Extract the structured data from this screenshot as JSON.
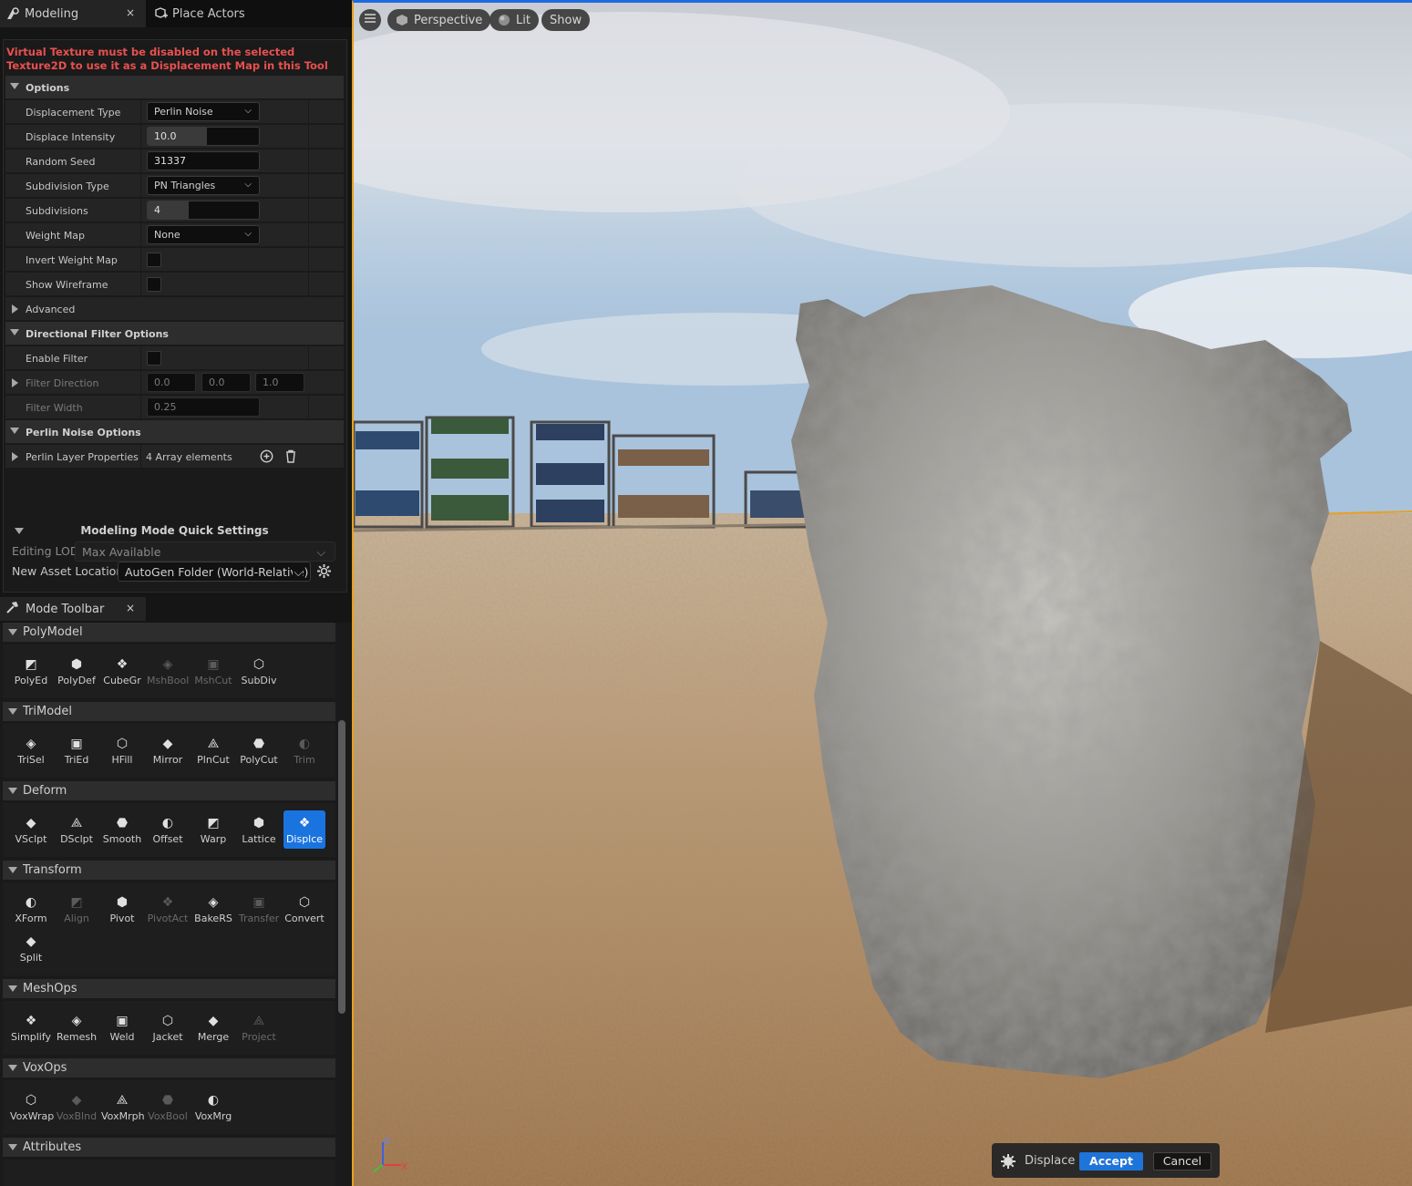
{
  "tabs": {
    "modeling": "Modeling",
    "place_actors": "Place Actors",
    "close": "×"
  },
  "warning": "Virtual Texture must be disabled on the selected Texture2D to use it as a Displacement Map in this Tool",
  "options": {
    "section": "Options",
    "displacement_type": {
      "label": "Displacement Type",
      "value": "Perlin Noise"
    },
    "displace_intensity": {
      "label": "Displace Intensity",
      "value": "10.0",
      "slider_fraction": 0.53
    },
    "random_seed": {
      "label": "Random Seed",
      "value": "31337"
    },
    "subdivision_type": {
      "label": "Subdivision Type",
      "value": "PN Triangles"
    },
    "subdivisions": {
      "label": "Subdivisions",
      "value": "4",
      "slider_fraction": 0.37
    },
    "weight_map": {
      "label": "Weight Map",
      "value": "None"
    },
    "invert_weight_map": {
      "label": "Invert Weight Map",
      "checked": false
    },
    "show_wireframe": {
      "label": "Show Wireframe",
      "checked": false
    },
    "advanced": "Advanced"
  },
  "directional": {
    "section": "Directional Filter Options",
    "enable_filter": {
      "label": "Enable Filter",
      "checked": false
    },
    "filter_direction": {
      "label": "Filter Direction",
      "x": "0.0",
      "y": "0.0",
      "z": "1.0"
    },
    "filter_width": {
      "label": "Filter Width",
      "value": "0.25"
    }
  },
  "perlin": {
    "section": "Perlin Noise Options",
    "layer_props": {
      "label": "Perlin Layer Properties",
      "value": "4 Array elements"
    }
  },
  "quick_settings": {
    "title": "Modeling Mode Quick Settings",
    "editing_lod": {
      "label": "Editing LOD",
      "value": "Max Available"
    },
    "new_asset_location": {
      "label": "New Asset Location",
      "value": "AutoGen Folder (World-Relative)"
    }
  },
  "mode_toolbar": {
    "title": "Mode Toolbar",
    "groups": [
      {
        "name": "PolyModel",
        "tools": [
          "PolyEd",
          "PolyDef",
          "CubeGr",
          "MshBool",
          "MshCut",
          "SubDiv"
        ]
      },
      {
        "name": "TriModel",
        "tools": [
          "TriSel",
          "TriEd",
          "HFill",
          "Mirror",
          "PlnCut",
          "PolyCut",
          "Trim"
        ]
      },
      {
        "name": "Deform",
        "tools": [
          "VSclpt",
          "DSclpt",
          "Smooth",
          "Offset",
          "Warp",
          "Lattice",
          "Displce"
        ]
      },
      {
        "name": "Transform",
        "tools": [
          "XForm",
          "Align",
          "Pivot",
          "PivotAct",
          "BakeRS",
          "Transfer",
          "Convert",
          "Split"
        ]
      },
      {
        "name": "MeshOps",
        "tools": [
          "Simplify",
          "Remesh",
          "Weld",
          "Jacket",
          "Merge",
          "Project"
        ]
      },
      {
        "name": "VoxOps",
        "tools": [
          "VoxWrap",
          "VoxBlnd",
          "VoxMrph",
          "VoxBool",
          "VoxMrg"
        ]
      },
      {
        "name": "Attributes",
        "tools": []
      }
    ]
  },
  "viewport": {
    "perspective": "Perspective",
    "lit": "Lit",
    "show": "Show",
    "tool_name": "Displace",
    "accept": "Accept",
    "cancel": "Cancel",
    "axis_x": "X",
    "axis_z": "Z"
  },
  "colors": {
    "accent": "#1a74e0",
    "warning": "#e85050",
    "viewport_border": "#e8a020"
  }
}
